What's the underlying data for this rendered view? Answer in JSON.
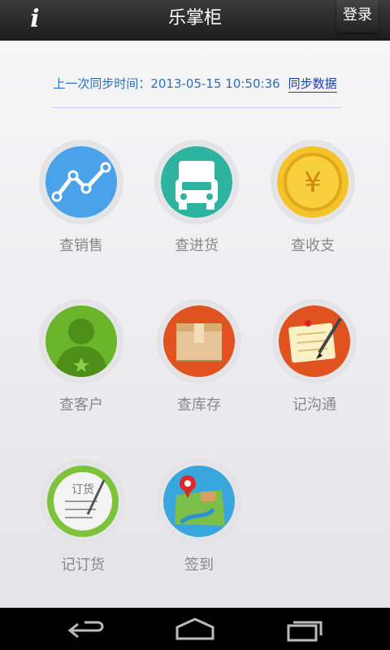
{
  "header": {
    "info_icon": "i",
    "title": "乐掌柜",
    "login_label": "登录"
  },
  "sync": {
    "label": "上一次同步时间：",
    "time": "2013-05-15 10:50:36",
    "link": "同步数据"
  },
  "tiles": [
    {
      "label": "查销售",
      "icon": "line-chart-icon",
      "color": "#4aa3ea"
    },
    {
      "label": "查进货",
      "icon": "truck-icon",
      "color": "#2fb3a1"
    },
    {
      "label": "查收支",
      "icon": "yen-coin-icon",
      "color": "#f4c32c"
    },
    {
      "label": "查客户",
      "icon": "customer-icon",
      "color": "#6ab52a"
    },
    {
      "label": "查库存",
      "icon": "box-icon",
      "color": "#e0521f"
    },
    {
      "label": "记沟通",
      "icon": "notepad-icon",
      "color": "#e0521f"
    },
    {
      "label": "记订货",
      "icon": "order-list-icon",
      "color": "#7cc23a",
      "icon_text": "订货"
    },
    {
      "label": "签到",
      "icon": "map-pin-icon",
      "color": "#3aa6de"
    }
  ],
  "navbar": {
    "back": "back-icon",
    "home": "home-icon",
    "recent": "recent-apps-icon"
  }
}
